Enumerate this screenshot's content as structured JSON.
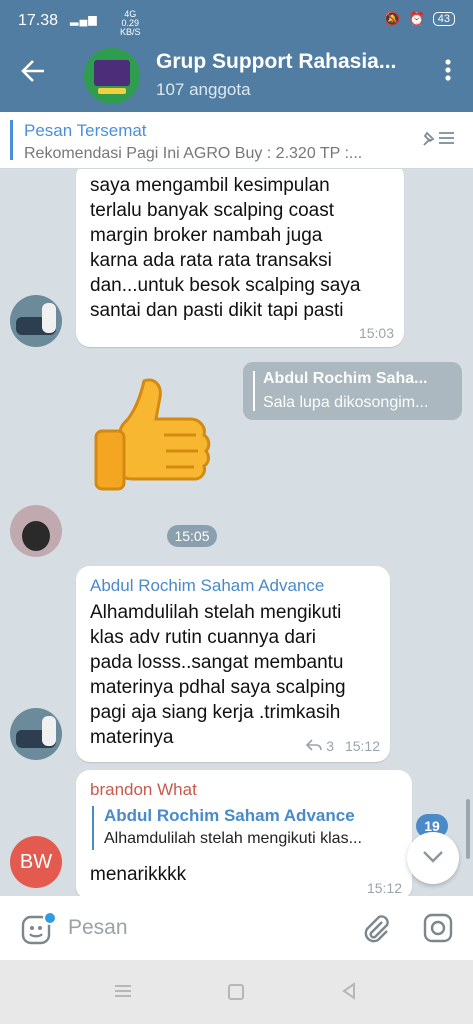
{
  "status": {
    "time": "17.38",
    "net_top": "4G",
    "speed": "0.29",
    "speed_unit": "KB/S",
    "battery": "43"
  },
  "header": {
    "title": "Grup Support Rahasia...",
    "subtitle": "107 anggota"
  },
  "pinned": {
    "title": "Pesan Tersemat",
    "text": "Rekomendasi Pagi Ini  AGRO  Buy : 2.320 TP :..."
  },
  "messages": {
    "m1": {
      "lines": [
        "saya mengambil kesimpulan",
        "terlalu banyak scalping coast",
        "margin broker nambah juga",
        "karna ada rata rata transaksi",
        "dan...untuk besok scalping saya",
        "santai dan pasti dikit tapi pasti"
      ],
      "time": "15:03"
    },
    "reply_out": {
      "name": "Abdul Rochim Saha...",
      "text": "Sala lupa dikosongim..."
    },
    "sticker_time": "15:05",
    "m2": {
      "sender": "Abdul Rochim Saham Advance",
      "lines": [
        "Alhamdulilah stelah mengikuti",
        "klas adv rutin cuannya dari",
        "pada losss..sangat membantu",
        "materinya pdhal saya scalping",
        "pagi aja siang kerja .trimkasih",
        "materinya"
      ],
      "replies": "3",
      "time": "15:12"
    },
    "m3": {
      "sender": "brandon What",
      "quote_name": "Abdul Rochim Saham Advance",
      "quote_text": "Alhamdulilah stelah mengikuti klas...",
      "text": "menarikkkk",
      "time": "15:12"
    }
  },
  "avatars": {
    "bw_initials": "BW"
  },
  "unread_badge": "19",
  "input": {
    "placeholder": "Pesan"
  },
  "icons": [
    "back-arrow-icon",
    "more-vert-icon",
    "pin-list-icon",
    "thumbs-up-sticker",
    "sticker-icon",
    "attach-icon",
    "camera-icon",
    "chevron-down-icon",
    "reply-icon"
  ]
}
